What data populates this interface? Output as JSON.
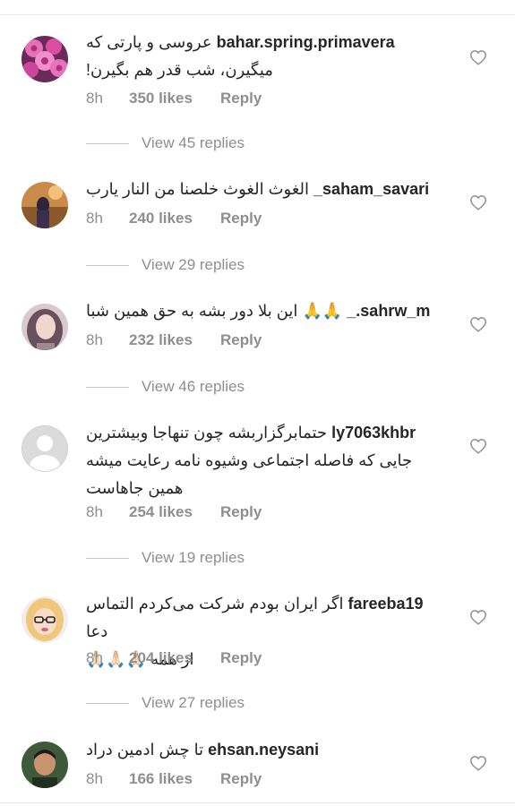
{
  "comments": [
    {
      "username": "bahar.spring.primavera",
      "text_line1": "عروسی و پارتی که",
      "text_line2": "میگیرن، شب قدر هم بگیرن!",
      "time": "8h",
      "likes": "350 likes",
      "reply": "Reply",
      "view_replies": "View 45 replies",
      "avatar": "pink-roses"
    },
    {
      "username": "_saham_savari",
      "text_line1": "الغوث الغوث خلصنا من النار یارب",
      "time": "8h",
      "likes": "240 likes",
      "reply": "Reply",
      "view_replies": "View 29 replies",
      "avatar": "person-outdoors"
    },
    {
      "username": "_.sahrw_m",
      "text_line1": "این بلا دور بشه به حق همین شبا",
      "emoji": "🙏🙏",
      "time": "8h",
      "likes": "232 likes",
      "reply": "Reply",
      "view_replies": "View 46 replies",
      "avatar": "woman-portrait"
    },
    {
      "username": "ly7063khbr",
      "text_line1": "حتمابرگزاربشه چون تنهاجا وبیشترین",
      "text_line2": "جایی که فاصله اجتماعی وشیوه نامه رعایت میشه",
      "text_line3": "همین جاهاست",
      "time": "8h",
      "likes": "254 likes",
      "reply": "Reply",
      "view_replies": "View 19 replies",
      "avatar": "default-silhouette"
    },
    {
      "username": "fareeba19",
      "text_line1": "اگر ایران بودم شرکت می‌کردم التماس دعا",
      "text_line2": "از همه",
      "emoji": "🙏🏻🙏🏻🙏🏻",
      "time": "8h",
      "likes": "204 likes",
      "reply": "Reply",
      "view_replies": "View 27 replies",
      "avatar": "cartoon-blonde"
    },
    {
      "username": "ehsan.neysani",
      "text_line1": "تا چش ادمین دراد",
      "time": "8h",
      "likes": "166 likes",
      "reply": "Reply",
      "avatar": "man-portrait"
    }
  ],
  "icons": {
    "heart": "heart-outline-icon"
  },
  "colors": {
    "text": "#262626",
    "secondary": "#8e8e8e",
    "divider": "#c7c7c7"
  }
}
